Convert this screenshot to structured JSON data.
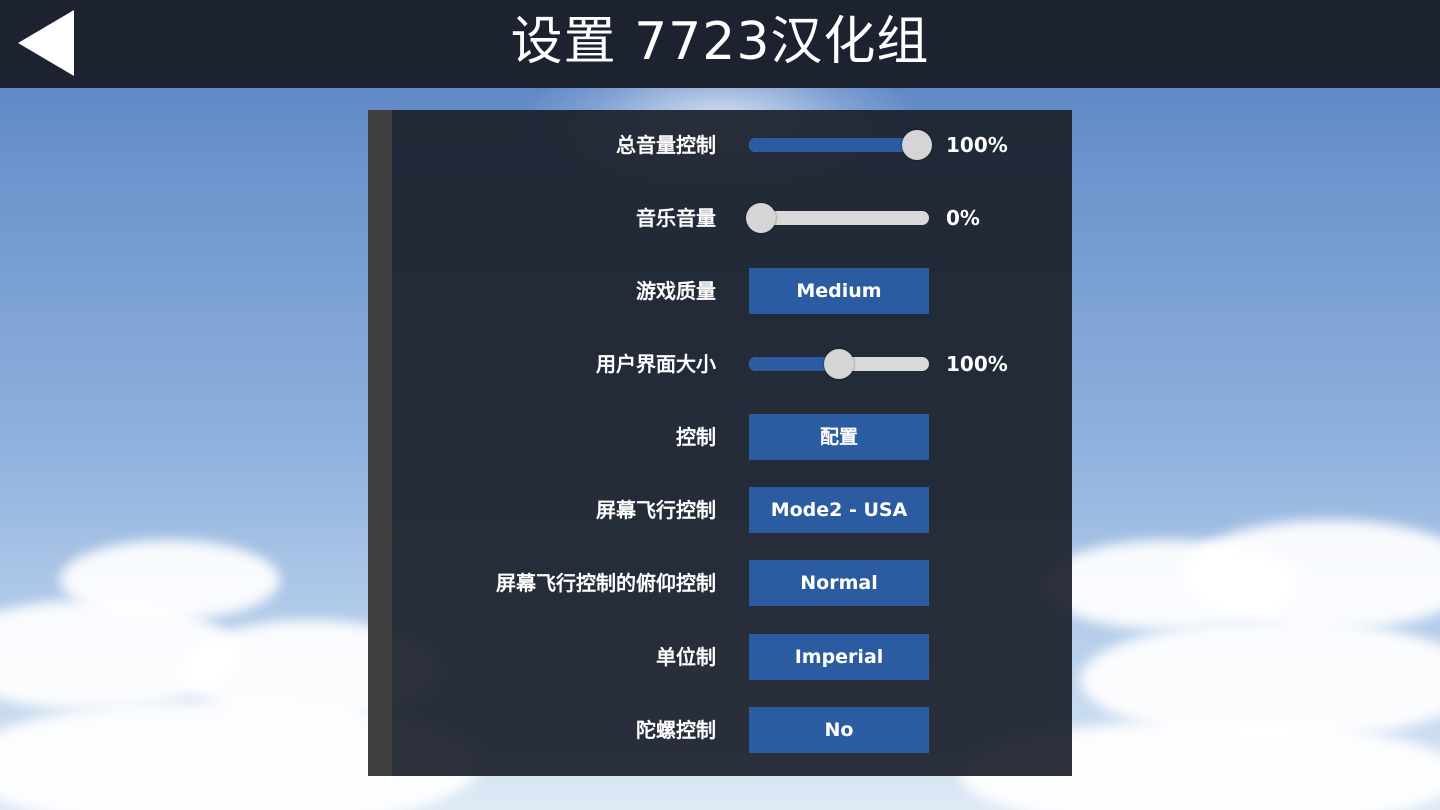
{
  "header": {
    "title": "设置 7723汉化组",
    "back_icon": "back-arrow-icon"
  },
  "colors": {
    "accent": "#2b5ca2",
    "topbar": "#1c2230",
    "panel": "#1c212c"
  },
  "settings": [
    {
      "label": "总音量控制",
      "type": "slider",
      "level": 1.0,
      "value": "100%"
    },
    {
      "label": "音乐音量",
      "type": "slider",
      "level": 0.0,
      "value": "0%"
    },
    {
      "label": "游戏质量",
      "type": "button",
      "value": "Medium"
    },
    {
      "label": "用户界面大小",
      "type": "slider",
      "level": 0.5,
      "value": "100%"
    },
    {
      "label": "控制",
      "type": "button",
      "value": "配置"
    },
    {
      "label": "屏幕飞行控制",
      "type": "button",
      "value": "Mode2 - USA"
    },
    {
      "label": "屏幕飞行控制的俯仰控制",
      "type": "button",
      "value": "Normal"
    },
    {
      "label": "单位制",
      "type": "button",
      "value": "Imperial"
    },
    {
      "label": "陀螺控制",
      "type": "button",
      "value": "No"
    }
  ]
}
